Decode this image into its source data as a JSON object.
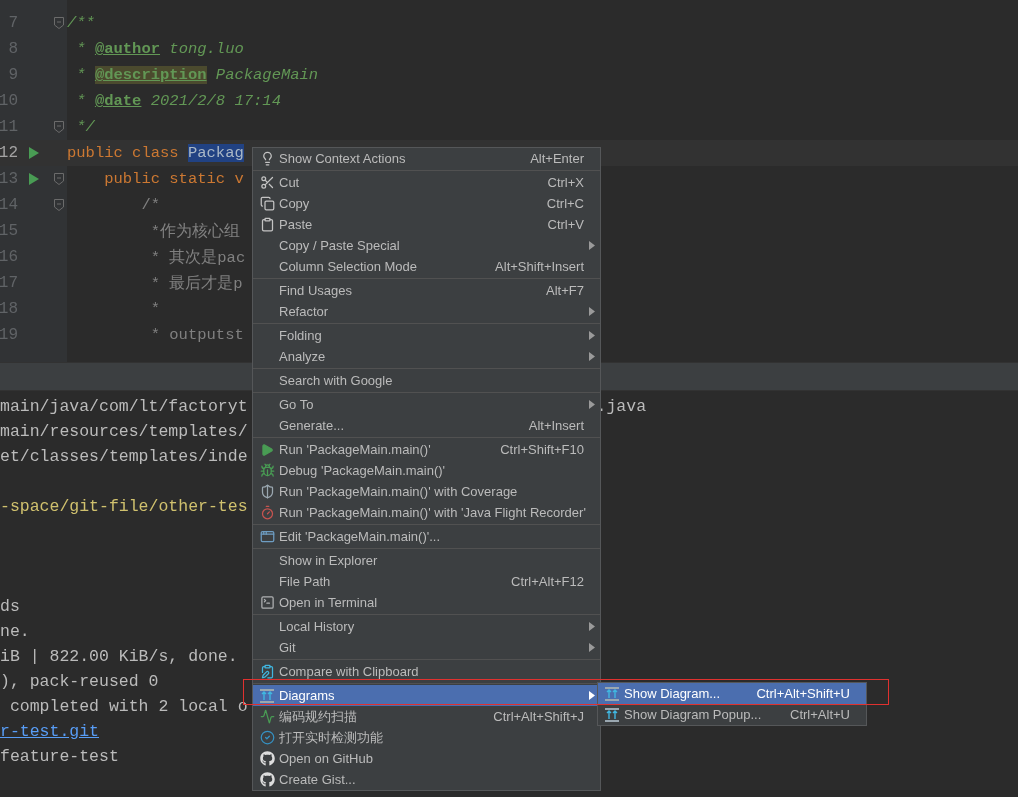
{
  "editor": {
    "lines": [
      {
        "number": "7",
        "run": false,
        "fold": true,
        "current": false,
        "segments": [
          {
            "text": "/**",
            "kind": "doc"
          }
        ]
      },
      {
        "number": "8",
        "run": false,
        "fold": false,
        "current": false,
        "segments": [
          {
            "text": " * ",
            "kind": "doc"
          },
          {
            "text": "@author",
            "kind": "doctag"
          },
          {
            "text": " tong.luo",
            "kind": "docvalue"
          }
        ]
      },
      {
        "number": "9",
        "run": false,
        "fold": false,
        "current": false,
        "segments": [
          {
            "text": " * ",
            "kind": "doc"
          },
          {
            "text": "@description",
            "kind": "doctag_marked"
          },
          {
            "text": " PackageMain",
            "kind": "docvalue"
          }
        ]
      },
      {
        "number": "10",
        "run": false,
        "fold": false,
        "current": false,
        "segments": [
          {
            "text": " * ",
            "kind": "doc"
          },
          {
            "text": "@date",
            "kind": "doctag"
          },
          {
            "text": " 2021/2/8 17:14",
            "kind": "docvalue"
          }
        ]
      },
      {
        "number": "11",
        "run": false,
        "fold": true,
        "current": false,
        "segments": [
          {
            "text": " */",
            "kind": "doc"
          }
        ]
      },
      {
        "number": "12",
        "run": true,
        "fold": false,
        "current": true,
        "segments": [
          {
            "text": "public class ",
            "kind": "keyword"
          },
          {
            "text": "Packag",
            "kind": "selection"
          }
        ]
      },
      {
        "number": "13",
        "run": true,
        "fold": true,
        "current": false,
        "segments": [
          {
            "text": "    public static v",
            "kind": "keyword"
          }
        ]
      },
      {
        "number": "14",
        "run": false,
        "fold": true,
        "current": false,
        "segments": [
          {
            "text": "        /*",
            "kind": "comment"
          }
        ]
      },
      {
        "number": "15",
        "run": false,
        "fold": false,
        "current": false,
        "segments": [
          {
            "text": "         *作为核心组",
            "kind": "comment"
          }
        ]
      },
      {
        "number": "16",
        "run": false,
        "fold": false,
        "current": false,
        "segments": [
          {
            "text": "         * 其次是pac",
            "kind": "comment"
          }
        ]
      },
      {
        "number": "17",
        "run": false,
        "fold": false,
        "current": false,
        "segments": [
          {
            "text": "         * 最后才是p",
            "kind": "comment"
          }
        ]
      },
      {
        "number": "18",
        "run": false,
        "fold": false,
        "current": false,
        "segments": [
          {
            "text": "         *",
            "kind": "comment"
          }
        ]
      },
      {
        "number": "19",
        "run": false,
        "fold": false,
        "current": false,
        "segments": [
          {
            "text": "         * outputst",
            "kind": "comment"
          }
        ]
      }
    ]
  },
  "console": {
    "lines": [
      {
        "kind": "plain",
        "text": "main/java/com/lt/factoryt",
        "tail": ".java"
      },
      {
        "kind": "plain",
        "text": "main/resources/templates/"
      },
      {
        "kind": "plain",
        "text": "et/classes/templates/inde"
      },
      {
        "kind": "blank"
      },
      {
        "kind": "path",
        "text": "-space/git-file/other-tes"
      },
      {
        "kind": "blank"
      },
      {
        "kind": "blank"
      },
      {
        "kind": "blank"
      },
      {
        "kind": "plain",
        "text": "ds"
      },
      {
        "kind": "plain",
        "text": "ne."
      },
      {
        "kind": "plain",
        "text": "iB | 822.00 KiB/s, done."
      },
      {
        "kind": "plain",
        "text": "), pack-reused 0"
      },
      {
        "kind": "plain",
        "text": " completed with 2 local o"
      },
      {
        "kind": "link",
        "text": "r-test.git"
      },
      {
        "kind": "plain",
        "text": "feature-test"
      }
    ]
  },
  "menu": {
    "groups": [
      {
        "items": [
          {
            "kind": "bulb",
            "label": "Show Context Actions",
            "shortcut": "Alt+Enter",
            "submenu": false,
            "selected": false
          }
        ]
      },
      {
        "items": [
          {
            "kind": "cut",
            "label": "Cut",
            "shortcut": "Ctrl+X",
            "submenu": false,
            "selected": false
          },
          {
            "kind": "copy",
            "label": "Copy",
            "shortcut": "Ctrl+C",
            "submenu": false,
            "selected": false
          },
          {
            "kind": "paste",
            "label": "Paste",
            "shortcut": "Ctrl+V",
            "submenu": false,
            "selected": false
          },
          {
            "label": "Copy / Paste Special",
            "submenu": true,
            "selected": false
          },
          {
            "label": "Column Selection Mode",
            "shortcut": "Alt+Shift+Insert",
            "submenu": false,
            "selected": false
          }
        ]
      },
      {
        "items": [
          {
            "label": "Find Usages",
            "shortcut": "Alt+F7",
            "submenu": false,
            "selected": false
          },
          {
            "label": "Refactor",
            "submenu": true,
            "selected": false
          }
        ]
      },
      {
        "items": [
          {
            "label": "Folding",
            "submenu": true,
            "selected": false
          },
          {
            "label": "Analyze",
            "submenu": true,
            "selected": false
          }
        ]
      },
      {
        "items": [
          {
            "label": "Search with Google",
            "submenu": false,
            "selected": false
          }
        ]
      },
      {
        "items": [
          {
            "label": "Go To",
            "submenu": true,
            "selected": false
          },
          {
            "label": "Generate...",
            "shortcut": "Alt+Insert",
            "submenu": false,
            "selected": false
          }
        ]
      },
      {
        "items": [
          {
            "kind": "run",
            "label": "Run 'PackageMain.main()'",
            "shortcut": "Ctrl+Shift+F10",
            "submenu": false,
            "selected": false
          },
          {
            "kind": "debug",
            "label": "Debug 'PackageMain.main()'",
            "submenu": false,
            "selected": false
          },
          {
            "kind": "coverage",
            "label": "Run 'PackageMain.main()' with Coverage",
            "submenu": false,
            "selected": false
          },
          {
            "kind": "profiler",
            "label": "Run 'PackageMain.main()' with 'Java Flight Recorder'",
            "submenu": false,
            "selected": false
          }
        ]
      },
      {
        "items": [
          {
            "kind": "config",
            "label": "Edit 'PackageMain.main()'...",
            "submenu": false,
            "selected": false
          }
        ]
      },
      {
        "items": [
          {
            "label": "Show in Explorer",
            "submenu": false,
            "selected": false
          },
          {
            "label": "File Path",
            "shortcut": "Ctrl+Alt+F12",
            "submenu": false,
            "selected": false
          },
          {
            "kind": "terminal",
            "label": "Open in Terminal",
            "submenu": false,
            "selected": false
          }
        ]
      },
      {
        "items": [
          {
            "label": "Local History",
            "submenu": true,
            "selected": false
          },
          {
            "label": "Git",
            "submenu": true,
            "selected": false
          }
        ]
      },
      {
        "items": [
          {
            "kind": "compare",
            "label": "Compare with Clipboard",
            "submenu": false,
            "selected": false
          }
        ]
      },
      {
        "items": [
          {
            "kind": "diagram",
            "label": "Diagrams",
            "submenu": true,
            "selected": true
          },
          {
            "kind": "scan",
            "label": "编码规约扫描",
            "shortcut": "Ctrl+Alt+Shift+J",
            "submenu": false,
            "selected": false
          },
          {
            "kind": "check",
            "label": "打开实时检测功能",
            "submenu": false,
            "selected": false
          },
          {
            "kind": "github",
            "label": "Open on GitHub",
            "submenu": false,
            "selected": false
          },
          {
            "kind": "github",
            "label": "Create Gist...",
            "submenu": false,
            "selected": false
          }
        ]
      }
    ]
  },
  "submenu": {
    "items": [
      {
        "kind": "diagram",
        "label": "Show Diagram...",
        "shortcut": "Ctrl+Alt+Shift+U",
        "selected": true
      },
      {
        "kind": "diagram",
        "label": "Show Diagram Popup...",
        "shortcut": "Ctrl+Alt+U",
        "selected": false
      }
    ]
  }
}
